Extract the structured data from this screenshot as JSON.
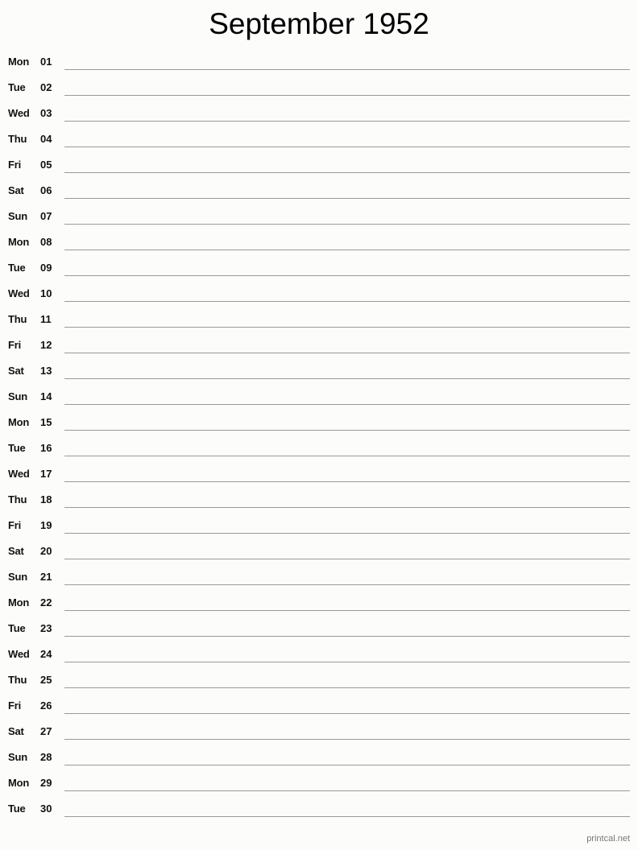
{
  "title": "September 1952",
  "days": [
    {
      "dow": "Mon",
      "day": "01"
    },
    {
      "dow": "Tue",
      "day": "02"
    },
    {
      "dow": "Wed",
      "day": "03"
    },
    {
      "dow": "Thu",
      "day": "04"
    },
    {
      "dow": "Fri",
      "day": "05"
    },
    {
      "dow": "Sat",
      "day": "06"
    },
    {
      "dow": "Sun",
      "day": "07"
    },
    {
      "dow": "Mon",
      "day": "08"
    },
    {
      "dow": "Tue",
      "day": "09"
    },
    {
      "dow": "Wed",
      "day": "10"
    },
    {
      "dow": "Thu",
      "day": "11"
    },
    {
      "dow": "Fri",
      "day": "12"
    },
    {
      "dow": "Sat",
      "day": "13"
    },
    {
      "dow": "Sun",
      "day": "14"
    },
    {
      "dow": "Mon",
      "day": "15"
    },
    {
      "dow": "Tue",
      "day": "16"
    },
    {
      "dow": "Wed",
      "day": "17"
    },
    {
      "dow": "Thu",
      "day": "18"
    },
    {
      "dow": "Fri",
      "day": "19"
    },
    {
      "dow": "Sat",
      "day": "20"
    },
    {
      "dow": "Sun",
      "day": "21"
    },
    {
      "dow": "Mon",
      "day": "22"
    },
    {
      "dow": "Tue",
      "day": "23"
    },
    {
      "dow": "Wed",
      "day": "24"
    },
    {
      "dow": "Thu",
      "day": "25"
    },
    {
      "dow": "Fri",
      "day": "26"
    },
    {
      "dow": "Sat",
      "day": "27"
    },
    {
      "dow": "Sun",
      "day": "28"
    },
    {
      "dow": "Mon",
      "day": "29"
    },
    {
      "dow": "Tue",
      "day": "30"
    }
  ],
  "footer": "printcal.net"
}
